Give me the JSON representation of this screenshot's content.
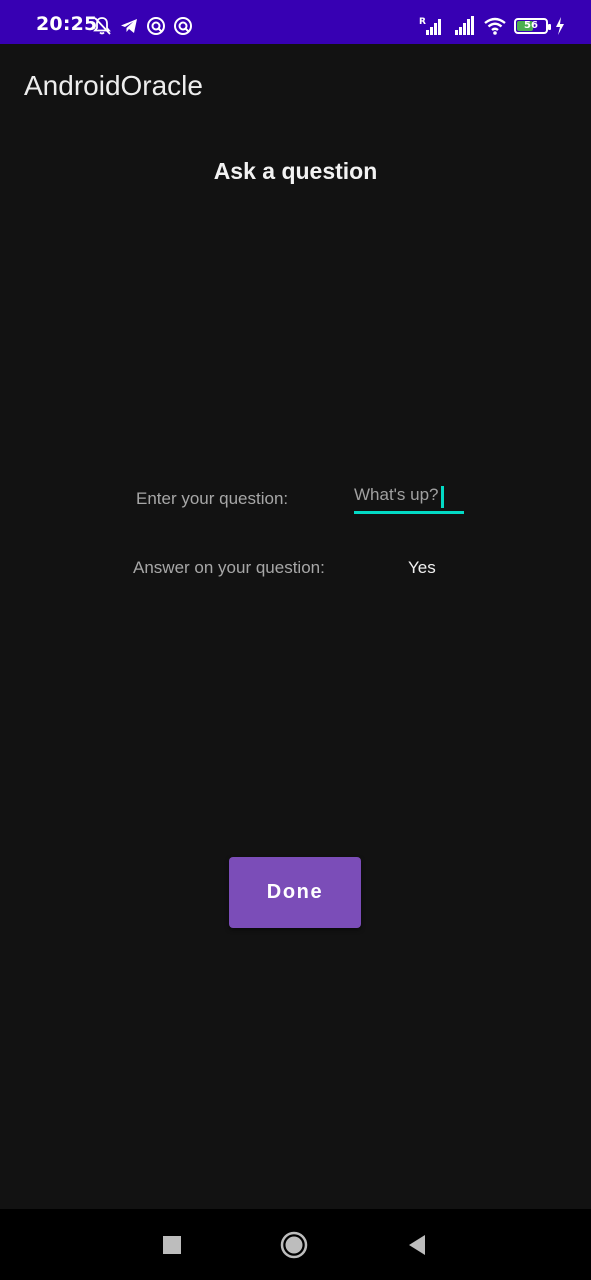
{
  "status_bar": {
    "time": "20:25",
    "battery_level": "56",
    "battery_fraction": 0.56,
    "left_icons": [
      "bell-off-icon",
      "telegram-icon",
      "vpn-icon",
      "vpn-icon"
    ],
    "right_icons": [
      "signal-icon",
      "signal-icon",
      "wifi-icon",
      "battery-icon",
      "charging-icon"
    ],
    "signal_roaming_letter": "R",
    "background_color": "#3700B3"
  },
  "app_bar": {
    "title": "AndroidOracle"
  },
  "main": {
    "heading": "Ask a question",
    "question_label": "Enter your question:",
    "question_value": "What's up?",
    "answer_label": "Answer on your question:",
    "answer_value": "Yes",
    "done_label": "Done",
    "accent_color": "#03DAC5",
    "button_color": "#7B4DB8"
  },
  "nav_bar": {
    "buttons": [
      "recents-icon",
      "home-icon",
      "back-icon"
    ]
  }
}
